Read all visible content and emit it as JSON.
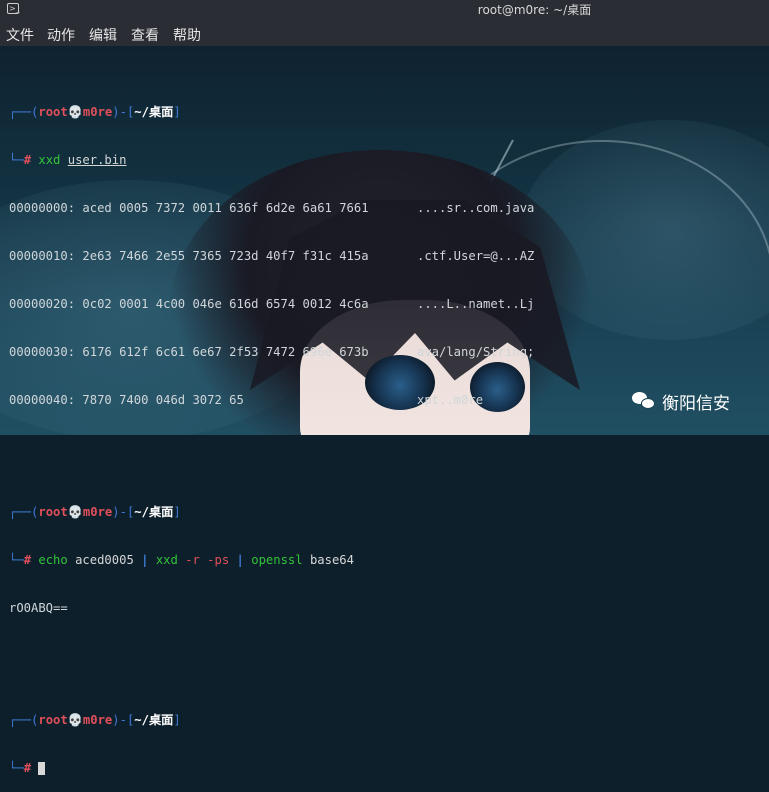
{
  "window": {
    "title": "root@m0re: ~/桌面"
  },
  "menu": [
    "文件",
    "动作",
    "编辑",
    "查看",
    "帮助"
  ],
  "prompt": {
    "user": "root",
    "skull": "💀",
    "host": "m0re",
    "path": "~/桌面",
    "symbol": "#"
  },
  "block1": {
    "cmd": "xxd",
    "file": "user.bin",
    "rows": [
      {
        "offset": "00000000:",
        "hex": "aced 0005 7372 0011 636f 6d2e 6a61 7661",
        "ascii": "....sr..com.java"
      },
      {
        "offset": "00000010:",
        "hex": "2e63 7466 2e55 7365 723d 40f7 f31c 415a",
        "ascii": ".ctf.User=@...AZ"
      },
      {
        "offset": "00000020:",
        "hex": "0c02 0001 4c00 046e 616d 6574 0012 4c6a",
        "ascii": "....L..namet..Lj"
      },
      {
        "offset": "00000030:",
        "hex": "6176 612f 6c61 6e67 2f53 7472 696e 673b",
        "ascii": "ava/lang/String;"
      },
      {
        "offset": "00000040:",
        "hex": "7870 7400 046d 3072 65",
        "ascii": "xpt..m0re"
      }
    ]
  },
  "block2": {
    "cmd1": "echo",
    "arg1": "aced0005",
    "pipe": "|",
    "cmd2": "xxd",
    "opt2": "-r -ps",
    "cmd3": "openssl",
    "arg3": "base64",
    "output": "rO0ABQ=="
  },
  "watermark": {
    "text": "衡阳信安",
    "icon": "wechat-icon"
  }
}
